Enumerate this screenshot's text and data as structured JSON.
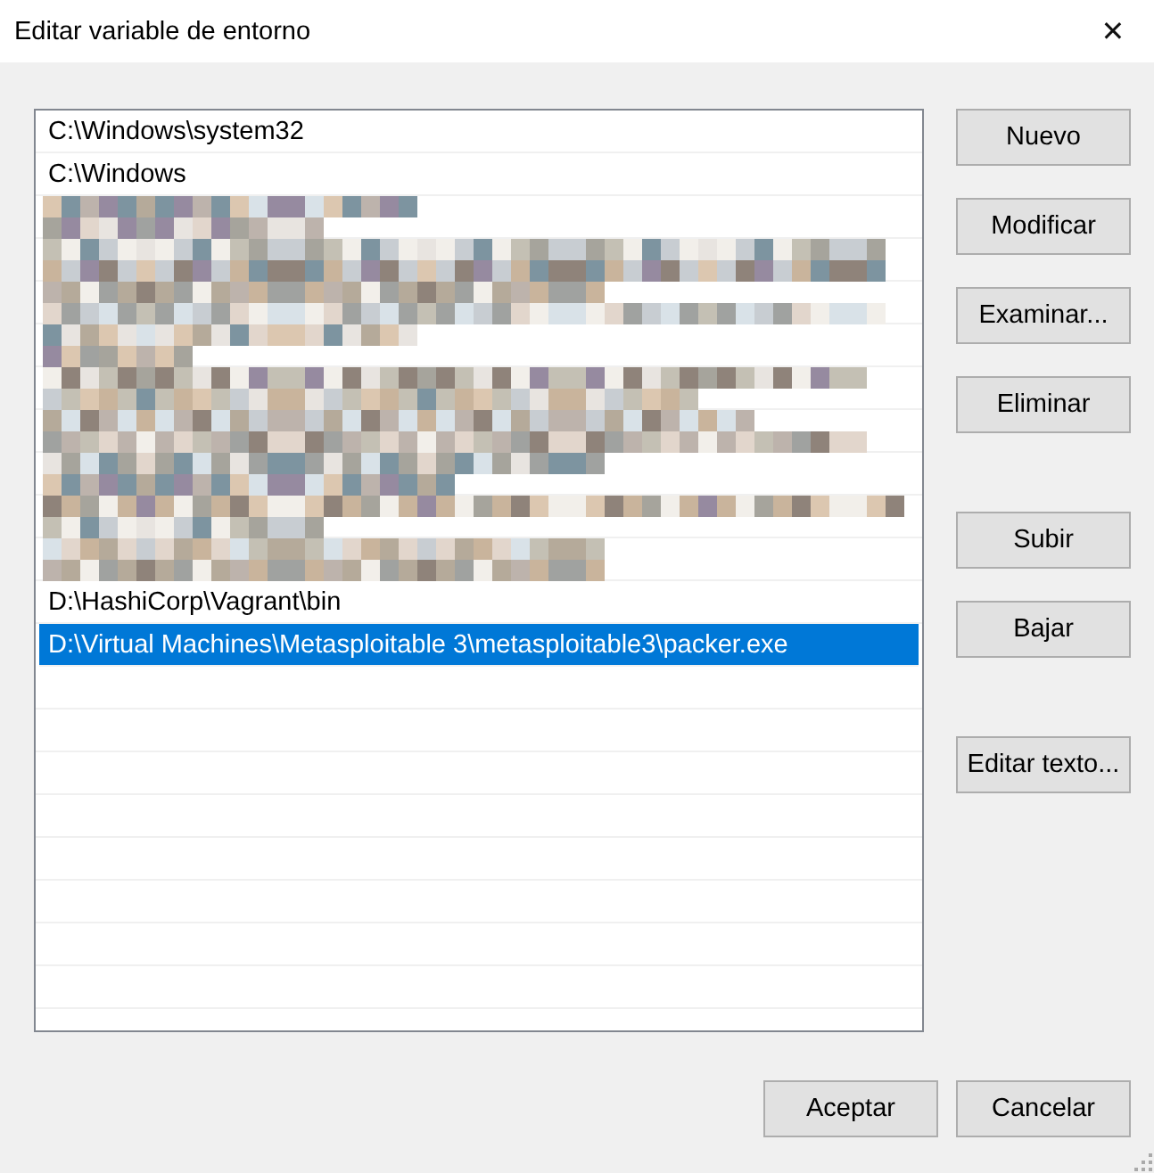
{
  "window": {
    "title": "Editar variable de entorno",
    "close": "✕"
  },
  "paths": [
    {
      "kind": "path",
      "text": "C:\\Windows\\system32",
      "selected": false
    },
    {
      "kind": "path",
      "text": "C:\\Windows",
      "selected": false
    },
    {
      "kind": "redacted"
    },
    {
      "kind": "redacted"
    },
    {
      "kind": "redacted"
    },
    {
      "kind": "redacted"
    },
    {
      "kind": "redacted"
    },
    {
      "kind": "redacted"
    },
    {
      "kind": "redacted"
    },
    {
      "kind": "redacted"
    },
    {
      "kind": "redacted"
    },
    {
      "kind": "path",
      "text": "D:\\HashiCorp\\Vagrant\\bin",
      "selected": false
    },
    {
      "kind": "path",
      "text": "D:\\Virtual Machines\\Metasploitable 3\\metasploitable3\\packer.exe",
      "selected": true
    },
    {
      "kind": "empty"
    },
    {
      "kind": "empty"
    },
    {
      "kind": "empty"
    },
    {
      "kind": "empty"
    },
    {
      "kind": "empty"
    },
    {
      "kind": "empty"
    },
    {
      "kind": "empty"
    },
    {
      "kind": "empty"
    }
  ],
  "side_buttons": [
    [
      "Nuevo",
      "Modificar",
      "Examinar...",
      "Eliminar"
    ],
    [
      "Subir",
      "Bajar"
    ],
    [
      "Editar texto..."
    ]
  ],
  "footer_buttons": [
    "Aceptar",
    "Cancelar"
  ]
}
